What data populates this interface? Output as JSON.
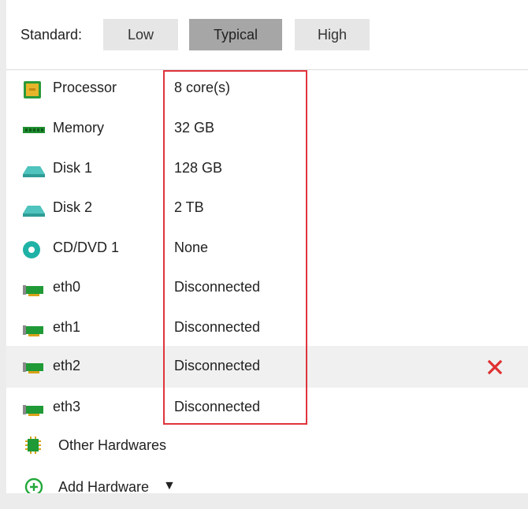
{
  "standard": {
    "label": "Standard:",
    "options": [
      "Low",
      "Typical",
      "High"
    ],
    "selected": "Typical"
  },
  "hardware": [
    {
      "name": "Processor",
      "value": "8 core(s)",
      "icon": "processor-icon"
    },
    {
      "name": "Memory",
      "value": "32 GB",
      "icon": "memory-icon"
    },
    {
      "name": "Disk 1",
      "value": "128 GB",
      "icon": "disk-icon"
    },
    {
      "name": "Disk 2",
      "value": "2 TB",
      "icon": "disk-icon"
    },
    {
      "name": "CD/DVD 1",
      "value": "None",
      "icon": "cd-dvd-icon"
    },
    {
      "name": "eth0",
      "value": "Disconnected",
      "icon": "network-card-icon"
    },
    {
      "name": "eth1",
      "value": "Disconnected",
      "icon": "network-card-icon"
    },
    {
      "name": "eth2",
      "value": "Disconnected",
      "icon": "network-card-icon",
      "selected": true
    },
    {
      "name": "eth3",
      "value": "Disconnected",
      "icon": "network-card-icon"
    }
  ],
  "remove_icon": "close-icon",
  "other_hardwares": {
    "label": "Other Hardwares",
    "icon": "chip-icon"
  },
  "add_hardware": {
    "label": "Add Hardware",
    "caret": "▼",
    "icon": "plus-circle-icon"
  },
  "colors": {
    "highlight": "#e0343c",
    "selected_button": "#a6a6a6",
    "button": "#e6e6e6",
    "remove": "#e03030",
    "accent_green": "#22a83a",
    "disk_teal": "#3fb6b0"
  }
}
